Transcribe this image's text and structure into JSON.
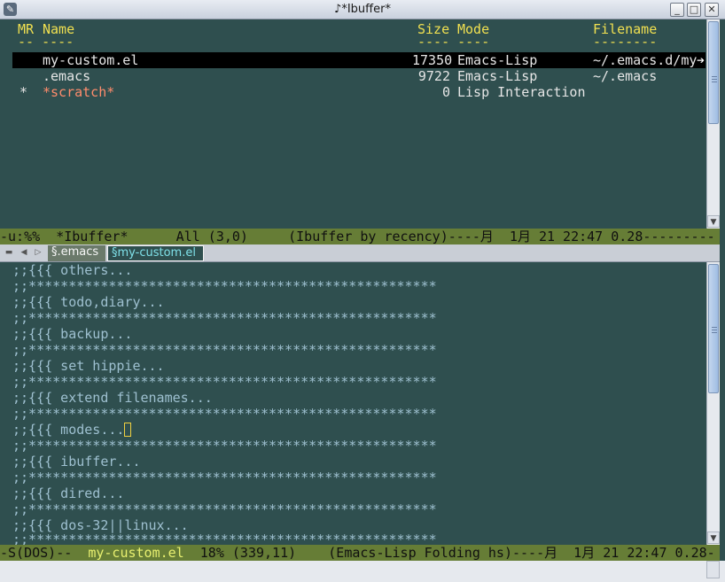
{
  "window": {
    "title": "♪*Ibuffer*",
    "app_icon": "emacs-icon",
    "controls": [
      "minimize",
      "maximize",
      "close"
    ]
  },
  "ibuffer": {
    "header": {
      "mr": "MR",
      "name": "Name",
      "size": "Size",
      "mode": "Mode",
      "filename": "Filename",
      "mr_underline": "-- ----",
      "size_underline": "---- ----",
      "filename_underline": "--------"
    },
    "rows": [
      {
        "mark": "",
        "name": "my-custom.el",
        "size": "17350",
        "mode": "Emacs-Lisp",
        "filename": "~/.emacs.d/my",
        "selected": true
      },
      {
        "mark": "",
        "name": ".emacs",
        "size": "9722",
        "mode": "Emacs-Lisp",
        "filename": "~/.emacs",
        "selected": false
      },
      {
        "mark": "*",
        "name": "*scratch*",
        "size": "0",
        "mode": "Lisp Interaction",
        "filename": "",
        "selected": false
      }
    ],
    "modeline": "-u:%%  *Ibuffer*      All (3,0)     (Ibuffer by recency)----月  1月 21 22:47 0.28---------"
  },
  "tabbar": {
    "tabs": [
      {
        "label": "§.emacs",
        "active": false
      },
      {
        "label": "§my-custom.el",
        "active": true
      }
    ]
  },
  "editor": {
    "lines": [
      ";;{{{ others...",
      ";;***************************************************",
      ";;{{{ todo,diary...",
      ";;***************************************************",
      ";;{{{ backup...",
      ";;***************************************************",
      ";;{{{ set hippie...",
      ";;***************************************************",
      ";;{{{ extend filenames...",
      ";;***************************************************",
      ";;{{{ modes...",
      ";;***************************************************",
      ";;{{{ ibuffer...",
      ";;***************************************************",
      ";;{{{ dired...",
      ";;***************************************************",
      ";;{{{ dos-32||linux...",
      ";;***************************************************"
    ],
    "cursor_line": 10,
    "modeline": {
      "prefix": "-S(DOS)--  ",
      "buffer": "my-custom.el",
      "rest": "  18% (339,11)    (Emacs-Lisp Folding hs)----月  1月 21 22:47 0.28-"
    }
  }
}
